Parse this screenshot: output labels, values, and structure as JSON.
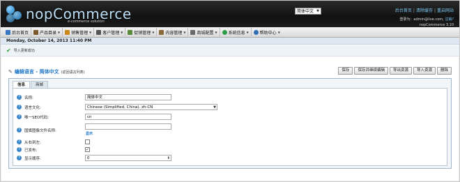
{
  "header": {
    "logo_text": "nopCommerce",
    "logo_sub": "e-commerce solution",
    "language_selected": "简体中文",
    "links": [
      "后台首页",
      "清除缓存",
      "重启网站"
    ],
    "login_prefix": "登录为：",
    "login_email": "admin@live.com",
    "logout": "注销?",
    "version": "nopCommerce 3.10"
  },
  "menu": {
    "items": [
      {
        "label": "后台首页",
        "icon": "home-icon",
        "color": "#3a78c2"
      },
      {
        "label": "产品目录",
        "icon": "catalog-icon",
        "color": "#7a5a2e"
      },
      {
        "label": "销售管理",
        "icon": "sales-icon",
        "color": "#c98a1b"
      },
      {
        "label": "客户管理",
        "icon": "customers-icon",
        "color": "#555555"
      },
      {
        "label": "促销管理",
        "icon": "promotions-icon",
        "color": "#5a8a3c"
      },
      {
        "label": "内容管理",
        "icon": "content-icon",
        "color": "#8a6a3a"
      },
      {
        "label": "商城配置",
        "icon": "config-icon",
        "color": "#6a6a6a"
      },
      {
        "label": "系统信息",
        "icon": "system-icon",
        "color": "#2e9e4d"
      },
      {
        "label": "帮助中心",
        "icon": "help-icon",
        "color": "#2f6db5"
      }
    ]
  },
  "datebar": {
    "text": "Monday, October 14, 2013 11:40 PM"
  },
  "notice": {
    "text": "导入更新成功"
  },
  "page": {
    "title": "编辑语言 - 简体中文",
    "back_link": "(返回语言列表)",
    "buttons": [
      "保存",
      "保存并继续编辑",
      "导出资源",
      "导入资源",
      "删除"
    ]
  },
  "tabs": [
    "信息",
    "商城"
  ],
  "form": {
    "name_label": "名称:",
    "name_value": "简体中文",
    "culture_label": "语言文化:",
    "culture_value": "Chinese (Simplified, China). zh-CN",
    "seo_label": "唯一SEO代码:",
    "seo_value": "cn",
    "flag_label": "国旗图像文件名称:",
    "flag_value": "",
    "flag_link": "显示",
    "rtl_label": "从右到左:",
    "published_label": "已发布:",
    "order_label": "显示顺序:",
    "order_value": "0"
  }
}
